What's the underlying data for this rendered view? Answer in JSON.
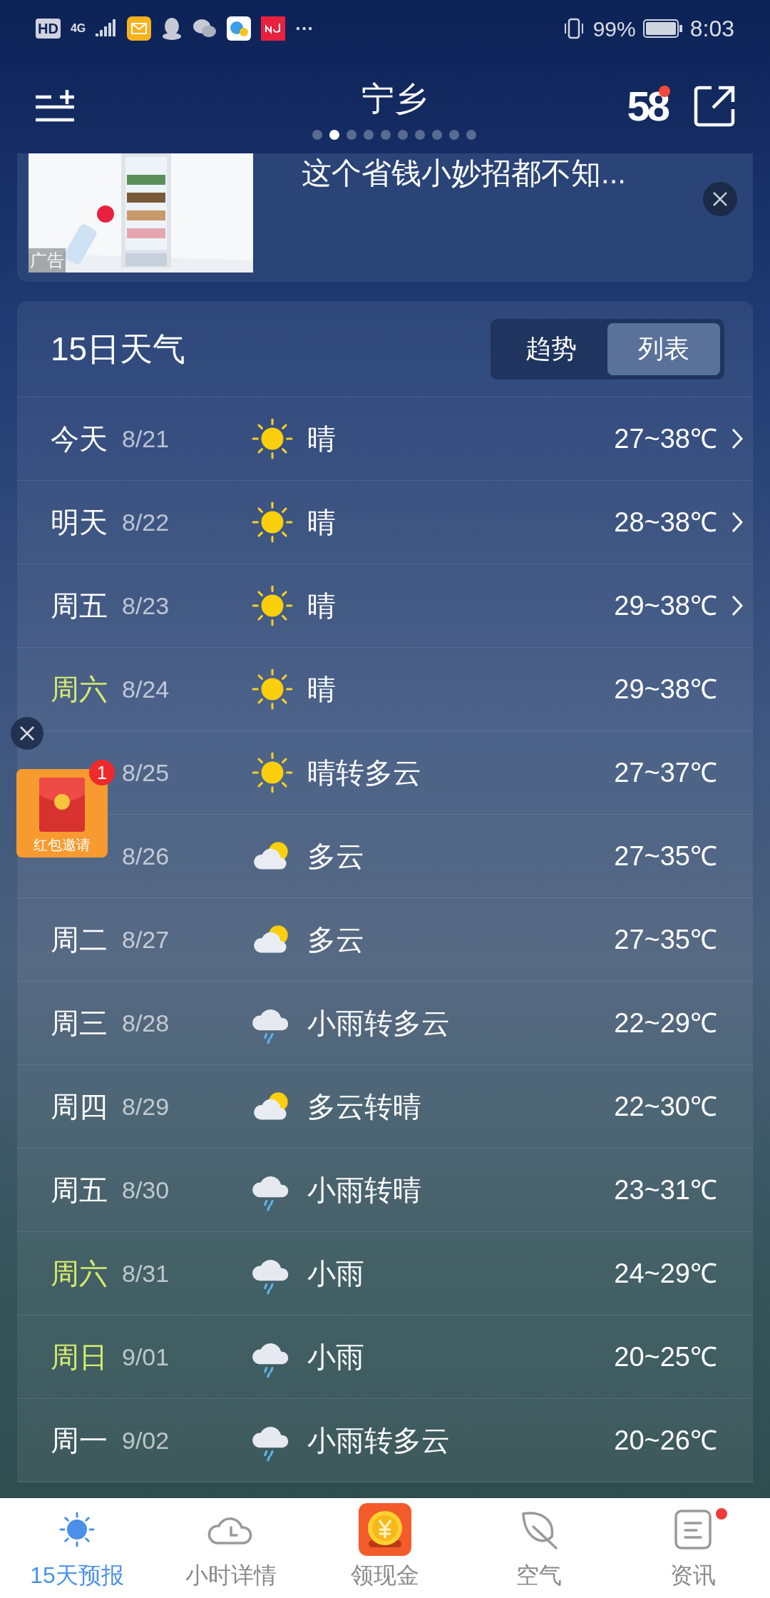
{
  "status_bar": {
    "left_texts": [
      "HD",
      "4G"
    ],
    "more": "···",
    "battery": "99%",
    "time": "8:03"
  },
  "header": {
    "title": "宁乡",
    "logo_text": "58",
    "logo_badge": true,
    "pages": [
      {
        "selected": false
      },
      {
        "selected": true
      },
      {
        "selected": false
      },
      {
        "selected": false
      },
      {
        "selected": false
      },
      {
        "selected": false
      },
      {
        "selected": false
      },
      {
        "selected": false
      },
      {
        "selected": false
      },
      {
        "selected": false
      }
    ]
  },
  "ad": {
    "label": "广告",
    "text": "这个省钱小妙招都不知..."
  },
  "forecast": {
    "title": "15日天气",
    "tabs": [
      {
        "label": "趋势",
        "selected": false
      },
      {
        "label": "列表",
        "selected": true
      }
    ],
    "rows": [
      {
        "day": "今天",
        "weekend": false,
        "date": "8/21",
        "kind": "sunny",
        "desc": "晴",
        "temp": "27~38℃",
        "expandable": true
      },
      {
        "day": "明天",
        "weekend": false,
        "date": "8/22",
        "kind": "sunny",
        "desc": "晴",
        "temp": "28~38℃",
        "expandable": true
      },
      {
        "day": "周五",
        "weekend": false,
        "date": "8/23",
        "kind": "sunny",
        "desc": "晴",
        "temp": "29~38℃",
        "expandable": true
      },
      {
        "day": "周六",
        "weekend": true,
        "date": "8/24",
        "kind": "sunny",
        "desc": "晴",
        "temp": "29~38℃",
        "expandable": false
      },
      {
        "date": "8/25",
        "kind": "sunny",
        "desc": "晴转多云",
        "temp": "27~37℃",
        "expandable": false
      },
      {
        "date": "8/26",
        "kind": "partly_cloudy",
        "desc": "多云",
        "temp": "27~35℃",
        "expandable": false
      },
      {
        "day": "周二",
        "weekend": false,
        "date": "8/27",
        "kind": "partly_cloudy",
        "desc": "多云",
        "temp": "27~35℃",
        "expandable": false
      },
      {
        "day": "周三",
        "weekend": false,
        "date": "8/28",
        "kind": "rain",
        "desc": "小雨转多云",
        "temp": "22~29℃",
        "expandable": false
      },
      {
        "day": "周四",
        "weekend": false,
        "date": "8/29",
        "kind": "partly_cloudy",
        "desc": "多云转晴",
        "temp": "22~30℃",
        "expandable": false
      },
      {
        "day": "周五",
        "weekend": false,
        "date": "8/30",
        "kind": "rain",
        "desc": "小雨转晴",
        "temp": "23~31℃",
        "expandable": false
      },
      {
        "day": "周六",
        "weekend": true,
        "date": "8/31",
        "kind": "rain",
        "desc": "小雨",
        "temp": "24~29℃",
        "expandable": false
      },
      {
        "day": "周日",
        "weekend": true,
        "date": "9/01",
        "kind": "rain",
        "desc": "小雨",
        "temp": "20~25℃",
        "expandable": false
      },
      {
        "day": "周一",
        "weekend": false,
        "date": "9/02",
        "kind": "rain",
        "desc": "小雨转多云",
        "temp": "20~26℃",
        "expandable": false
      }
    ]
  },
  "red_packet": {
    "label": "红包邀请",
    "badge": "1"
  },
  "bottom_nav": [
    {
      "label": "15天预报",
      "selected": true,
      "dot": false
    },
    {
      "label": "小时详情",
      "selected": false,
      "dot": false
    },
    {
      "label": "领现金",
      "selected": false,
      "dot": false
    },
    {
      "label": "空气",
      "selected": false,
      "dot": false
    },
    {
      "label": "资讯",
      "selected": false,
      "dot": true
    }
  ]
}
